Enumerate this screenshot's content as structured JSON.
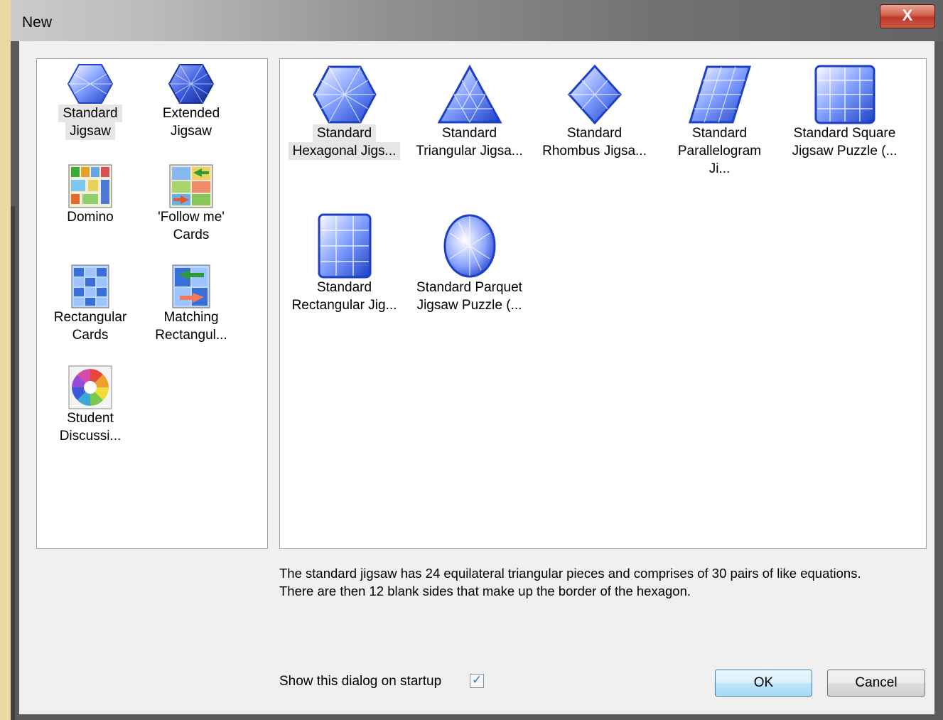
{
  "window": {
    "title": "New",
    "close_label": "X"
  },
  "categories": [
    {
      "label_lines": [
        "Standard",
        "Jigsaw"
      ],
      "icon": "hexagon-jigsaw-icon",
      "selected": true
    },
    {
      "label_lines": [
        "Extended",
        "Jigsaw"
      ],
      "icon": "extended-jigsaw-icon",
      "selected": false
    },
    {
      "label_lines": [
        "Domino"
      ],
      "icon": "domino-icon",
      "selected": false
    },
    {
      "label_lines": [
        "'Follow me'",
        "Cards"
      ],
      "icon": "follow-me-cards-icon",
      "selected": false
    },
    {
      "label_lines": [
        "Rectangular",
        "Cards"
      ],
      "icon": "rectangular-cards-icon",
      "selected": false
    },
    {
      "label_lines": [
        "Matching",
        "Rectangul..."
      ],
      "icon": "matching-rectangular-icon",
      "selected": false
    },
    {
      "label_lines": [
        "Student",
        "Discussi..."
      ],
      "icon": "student-discussion-icon",
      "selected": false
    }
  ],
  "templates": [
    {
      "label_lines": [
        "Standard",
        "Hexagonal Jigs..."
      ],
      "icon": "hexagon-icon",
      "selected": true
    },
    {
      "label_lines": [
        "Standard",
        "Triangular Jigsa..."
      ],
      "icon": "triangle-icon",
      "selected": false
    },
    {
      "label_lines": [
        "Standard",
        "Rhombus Jigsa..."
      ],
      "icon": "rhombus-icon",
      "selected": false
    },
    {
      "label_lines": [
        "Standard",
        "Parallelogram Ji..."
      ],
      "icon": "parallelogram-icon",
      "selected": false
    },
    {
      "label_lines": [
        "Standard Square",
        "Jigsaw Puzzle (..."
      ],
      "icon": "square-grid-icon",
      "selected": false
    },
    {
      "label_lines": [
        "Standard",
        "Rectangular Jig..."
      ],
      "icon": "rectangle-grid-icon",
      "selected": false
    },
    {
      "label_lines": [
        "Standard Parquet",
        "Jigsaw Puzzle (..."
      ],
      "icon": "parquet-icon",
      "selected": false
    }
  ],
  "description": {
    "line1": "The standard jigsaw has 24 equilateral triangular pieces and comprises of 30 pairs of like equations.",
    "line2": "There are then 12 blank sides that make up the border of the hexagon."
  },
  "startup": {
    "label": "Show this dialog on startup",
    "checked": true,
    "check_glyph": "✓"
  },
  "buttons": {
    "ok": "OK",
    "cancel": "Cancel"
  },
  "colors": {
    "accent_blue": "#1c3fc6",
    "light_blue": "#c8d6ff",
    "close_red": "#c0392b"
  }
}
